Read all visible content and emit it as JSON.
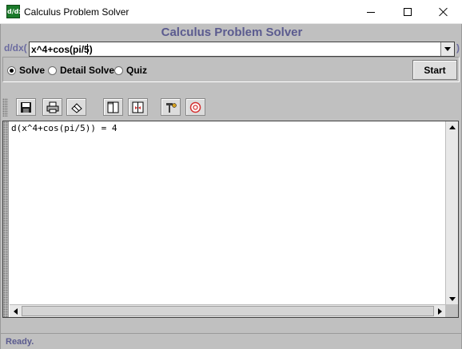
{
  "window": {
    "title": "Calculus Problem Solver",
    "icon_text": "d/dx"
  },
  "app": {
    "heading": "Calculus Problem Solver"
  },
  "expression": {
    "prefix": "d/dx(",
    "value": "x^4+cos(pi/5)",
    "suffix": ")"
  },
  "modes": {
    "options": [
      {
        "label": "Solve",
        "selected": true
      },
      {
        "label": "Detail Solve",
        "selected": false
      },
      {
        "label": "Quiz",
        "selected": false
      }
    ]
  },
  "start_button": {
    "label": "Start"
  },
  "toolbar": {
    "buttons": [
      {
        "icon": "save-icon"
      },
      {
        "icon": "print-icon"
      },
      {
        "icon": "eraser-icon"
      },
      {
        "icon": "split-view-icon"
      },
      {
        "icon": "swap-view-icon"
      },
      {
        "icon": "settings-icon"
      },
      {
        "icon": "help-icon"
      }
    ]
  },
  "output": {
    "text": "d(x^4+cos(pi/5)) = 4"
  },
  "status": {
    "text": "Ready."
  },
  "colors": {
    "heading": "#5b5b8f",
    "client_bg": "#c0c0c0",
    "app_icon": "#1b7a2a",
    "help_icon": "#d43030"
  }
}
